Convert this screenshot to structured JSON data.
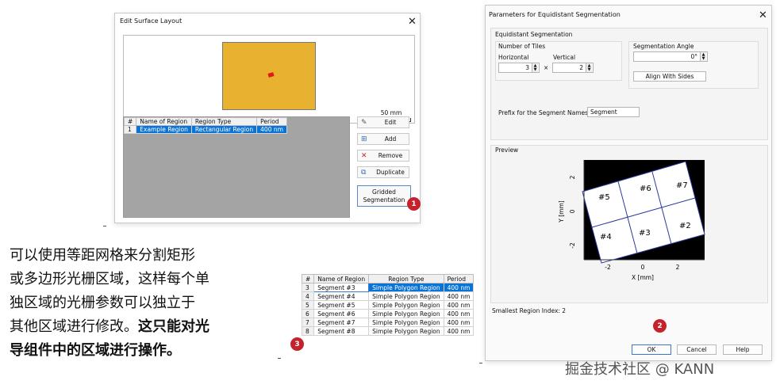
{
  "dialog1": {
    "title": "Edit Surface Layout",
    "scale_label": "50 mm",
    "table": {
      "headers": [
        "#",
        "Name of Region",
        "Region Type",
        "Period"
      ],
      "rows": [
        {
          "num": "1",
          "name": "Example Region",
          "type": "Rectangular Region",
          "period": "400 nm"
        }
      ]
    },
    "buttons": {
      "edit": "Edit",
      "add": "Add",
      "remove": "Remove",
      "duplicate": "Duplicate",
      "gridded_line1": "Gridded",
      "gridded_line2": "Segmentation"
    },
    "badge": "1"
  },
  "description": {
    "line1": "可以使用等距网格来分割矩形",
    "line2": "或多边形光栅区域，这样每个单",
    "line3": "独区域的光栅参数可以独立于",
    "line4_plain": "其他区域进行修改。",
    "line4_bold": "这只能对光",
    "line5_bold": "导组件中的区域进行操作。",
    "badge": "3"
  },
  "segment_table": {
    "headers": [
      "#",
      "Name of Region",
      "Region Type",
      "Period"
    ],
    "rows": [
      {
        "num": "3",
        "name": "Segment #3",
        "type": "Simple Polygon Region",
        "period": "400 nm"
      },
      {
        "num": "4",
        "name": "Segment #4",
        "type": "Simple Polygon Region",
        "period": "400 nm"
      },
      {
        "num": "5",
        "name": "Segment #5",
        "type": "Simple Polygon Region",
        "period": "400 nm"
      },
      {
        "num": "6",
        "name": "Segment #6",
        "type": "Simple Polygon Region",
        "period": "400 nm"
      },
      {
        "num": "7",
        "name": "Segment #7",
        "type": "Simple Polygon Region",
        "period": "400 nm"
      },
      {
        "num": "8",
        "name": "Segment #8",
        "type": "Simple Polygon Region",
        "period": "400 nm"
      }
    ]
  },
  "dialog2": {
    "title": "Parameters for Equidistant Segmentation",
    "equidistant_group": "Equidistant Segmentation",
    "number_of_tiles": "Number of Tiles",
    "horizontal_label": "Horizontal",
    "vertical_label": "Vertical",
    "horizontal_value": "3",
    "vertical_value": "2",
    "times": "×",
    "segmentation_angle": "Segmentation Angle",
    "angle_value": "0°",
    "align_button": "Align With Sides",
    "prefix_label": "Prefix for the Segment Names",
    "prefix_value": "Segment",
    "preview_label": "Preview",
    "plot": {
      "xlabel": "X [mm]",
      "ylabel": "Y [mm]",
      "xticks": [
        "-2",
        "0",
        "2"
      ],
      "yticks": [
        "2",
        "0",
        "-2"
      ],
      "segments": [
        "#5",
        "#6",
        "#7",
        "#4",
        "#3",
        "#2"
      ]
    },
    "smallest_region": "Smallest Region Index: 2",
    "ok": "OK",
    "cancel": "Cancel",
    "help": "Help",
    "badge": "2"
  },
  "watermark": "掘金技术社区 @ KANN"
}
